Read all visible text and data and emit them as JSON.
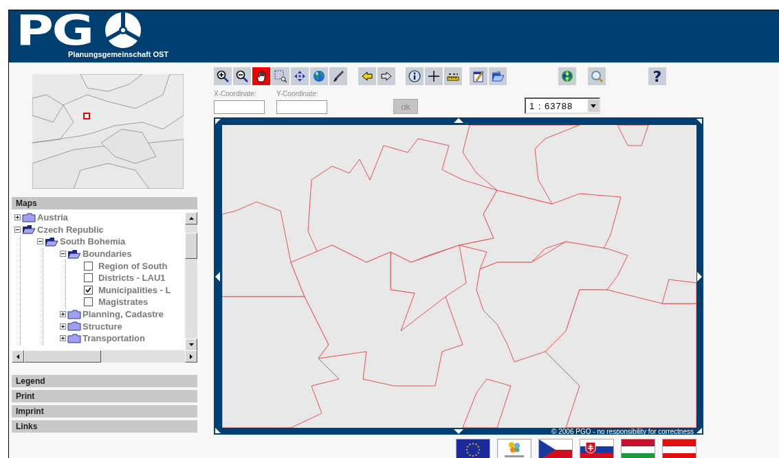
{
  "header": {
    "logo_text": "PG",
    "subtitle": "Planungsgemeinschaft OST"
  },
  "panels": [
    {
      "title": "Maps",
      "tree": [
        {
          "kind": "folder",
          "label": "Austria",
          "expanded": false
        },
        {
          "kind": "folder",
          "label": "Czech Republic",
          "expanded": true,
          "children": [
            {
              "kind": "folder",
              "label": "South Bohemia",
              "expanded": true,
              "children": [
                {
                  "kind": "folder",
                  "label": "Boundaries",
                  "expanded": true,
                  "children": [
                    {
                      "kind": "layer",
                      "label": "Region of South",
                      "checked": false
                    },
                    {
                      "kind": "layer",
                      "label": "Districts - LAU1",
                      "checked": false
                    },
                    {
                      "kind": "layer",
                      "label": "Municipalities - L",
                      "checked": true
                    },
                    {
                      "kind": "layer",
                      "label": "Magistrates",
                      "checked": false
                    }
                  ]
                },
                {
                  "kind": "folder",
                  "label": "Planning, Cadastre",
                  "expanded": false
                },
                {
                  "kind": "folder",
                  "label": "Structure",
                  "expanded": false
                },
                {
                  "kind": "folder",
                  "label": "Transportation",
                  "expanded": false
                }
              ]
            }
          ]
        }
      ]
    },
    {
      "title": "Legend"
    },
    {
      "title": "Print"
    },
    {
      "title": "Imprint"
    },
    {
      "title": "Links"
    }
  ],
  "toolbar": {
    "groups": [
      [
        {
          "kind": "zoom-in",
          "selected": false
        },
        {
          "kind": "zoom-out",
          "selected": false
        },
        {
          "kind": "pan",
          "selected": true
        },
        {
          "kind": "zoom-box",
          "selected": false
        },
        {
          "kind": "zoom-full",
          "selected": false
        },
        {
          "kind": "globe",
          "selected": false
        },
        {
          "kind": "brush",
          "selected": false
        }
      ],
      [
        {
          "kind": "back",
          "selected": false
        },
        {
          "kind": "forward",
          "selected": false
        }
      ],
      [
        {
          "kind": "info",
          "selected": false
        },
        {
          "kind": "crosshair",
          "selected": false
        },
        {
          "kind": "measure",
          "selected": false
        }
      ],
      [
        {
          "kind": "edit",
          "selected": false
        },
        {
          "kind": "open",
          "selected": false
        }
      ],
      [
        {
          "kind": "globe-arrows",
          "selected": false
        }
      ],
      [
        {
          "kind": "magnifier",
          "selected": false
        }
      ],
      [
        {
          "kind": "help",
          "selected": false,
          "label": "?"
        }
      ]
    ]
  },
  "coordinates": {
    "x_label": "X-Coordinate:",
    "y_label": "Y-Coordinate:",
    "ok_button": {
      "label": "ok",
      "disabled": true
    }
  },
  "scale": {
    "value": "1 : 63788"
  },
  "map": {
    "kind": "picture",
    "copyright": "© 2006 PGO - no responsibility for correctness"
  },
  "logos": [
    {
      "kind": "eu"
    },
    {
      "kind": "logo"
    },
    {
      "kind": "cz"
    },
    {
      "kind": "sk"
    },
    {
      "kind": "hu"
    },
    {
      "kind": "at"
    }
  ]
}
